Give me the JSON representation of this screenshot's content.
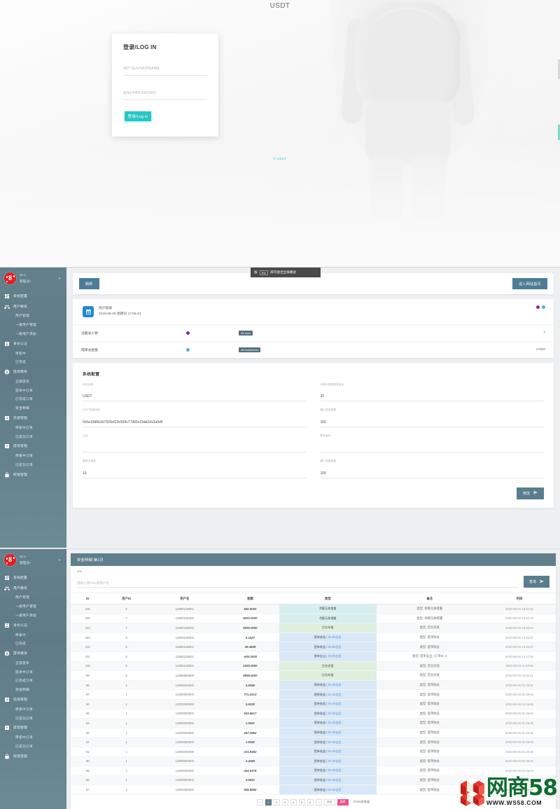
{
  "login": {
    "brand": "USDT",
    "title": "登录/LOG IN",
    "username_placeholder": "用户名/USERNAME",
    "password_placeholder": "密码/PASSWORD",
    "submit_label": "登录/Log in",
    "copyright": "© USDT"
  },
  "fullscreen_hint": {
    "prefix": "按",
    "key": "Esc",
    "suffix": "即可退出全屏模式"
  },
  "sidebar": {
    "user_id": "ID:1",
    "user_greeting": "管理员!",
    "caret": "▼",
    "items": [
      {
        "label": "系统配置",
        "icon": "grid-icon",
        "level": "top"
      },
      {
        "label": "用户模块",
        "icon": "users-icon",
        "level": "top"
      },
      {
        "label": "用户管理",
        "icon": "",
        "level": "child"
      },
      {
        "label": "一级用户管理",
        "icon": "",
        "level": "child"
      },
      {
        "label": "一级用户添加",
        "icon": "",
        "level": "child"
      },
      {
        "label": "身份认证",
        "icon": "id-card-icon",
        "level": "top"
      },
      {
        "label": "审核中",
        "icon": "",
        "level": "child"
      },
      {
        "label": "已完成",
        "icon": "",
        "level": "child"
      },
      {
        "label": "提单模块",
        "icon": "coin-icon",
        "level": "top"
      },
      {
        "label": "全部提单",
        "icon": "",
        "level": "child"
      },
      {
        "label": "提单中订单",
        "icon": "",
        "level": "child"
      },
      {
        "label": "已完成订单",
        "icon": "",
        "level": "child"
      },
      {
        "label": "资金明细",
        "icon": "",
        "level": "child"
      },
      {
        "label": "充值管理",
        "icon": "login-arrow-icon",
        "level": "top"
      },
      {
        "label": "审核中订单",
        "icon": "",
        "level": "child"
      },
      {
        "label": "已成功订单",
        "icon": "",
        "level": "child"
      },
      {
        "label": "提现管理",
        "icon": "export-icon",
        "level": "top"
      },
      {
        "label": "审核中订单",
        "icon": "",
        "level": "child"
      },
      {
        "label": "已成功订单",
        "icon": "",
        "level": "child"
      },
      {
        "label": "权限管理",
        "icon": "lock-icon",
        "level": "top"
      }
    ]
  },
  "admin": {
    "refresh_label": "刷新",
    "enter_site_label": "进入网站首页",
    "stats": {
      "icon": "calendar-chart-icon",
      "heading": "统计报表",
      "datetime": "2020-08-09  星期日  17:05:43",
      "rows": [
        {
          "label": "注册总人数",
          "tag": "All User",
          "value": "7",
          "color": "#8e24aa"
        },
        {
          "label": "提单总金额",
          "tag": "All Investment",
          "value": "17500",
          "color": "#5aa9e6"
        }
      ]
    },
    "config": {
      "title": "系统配置",
      "fields_left": [
        {
          "label": "站点名称",
          "value": "USDT"
        },
        {
          "label": "USDT收款地址",
          "value": "0x5a19d6b1b7920ef12e933c77d93c15ab2d13a9d5"
        },
        {
          "label": "公告",
          "value": ""
        },
        {
          "label": "提现手续费",
          "value": "10"
        }
      ],
      "fields_right": [
        {
          "label": "分享代理奖励奖金比",
          "value": "20"
        },
        {
          "label": "最小投资金额",
          "value": "100"
        },
        {
          "label": "联系我们",
          "value": ""
        },
        {
          "label": "最小充值金额",
          "value": "100"
        }
      ],
      "submit_label": "修改",
      "submit_icon": "send-icon"
    }
  },
  "fund_table": {
    "title": "资金明细-第1页",
    "search_label": "搜索",
    "search_placeholder": "请输入用户ID或用户名",
    "search_value": "",
    "search_button": "查询",
    "search_icon": "send-icon",
    "columns": [
      "ID",
      "用户ID",
      "用户名",
      "金额",
      "类型",
      "备注",
      "时间"
    ],
    "rows": [
      {
        "id": "106",
        "uid": "6",
        "user": "13800138001",
        "amount": "500.0000",
        "type": "余额无故增量",
        "type_sub": "",
        "tone": "teal",
        "remark": "类型: 余额无故增量",
        "time": "2020-08-03 16:57:32"
      },
      {
        "id": "105",
        "uid": "7",
        "user": "13800138200",
        "amount": "5000.0000",
        "type": "余额无故增量",
        "type_sub": "",
        "tone": "teal",
        "remark": "类型: 余额无故增量",
        "time": "2020-08-03 16:51:13"
      },
      {
        "id": "104",
        "uid": "7",
        "user": "13800138200",
        "amount": "8000.0000",
        "type": "后台充值",
        "type_sub": "",
        "tone": "green",
        "remark": "类型: 后台充值",
        "time": "2020-08-03 16:45:54"
      },
      {
        "id": "103",
        "uid": "6",
        "user": "13800138001",
        "amount": "0.1527",
        "type": "提单收益",
        "type_sub": "| ID-4/6会员",
        "tone": "blue",
        "remark": "类型: 提单收益",
        "time": "2020-08-03 14:25:37"
      },
      {
        "id": "102",
        "uid": "6",
        "user": "13800138001",
        "amount": "25.4949",
        "type": "提单收益",
        "type_sub": "| ID-4/6会员",
        "tone": "blue",
        "remark": "类型: 提单收益",
        "time": "2020-08-03 14:25:37"
      },
      {
        "id": "101",
        "uid": "6",
        "user": "13800138001",
        "amount": "-500.0000",
        "type": "提单支出",
        "type_sub": "| ID-4/6会员",
        "tone": "blue",
        "remark": "类型: 提单支出 | 订单ID: 4",
        "time": "2020-08-03 14:17:56"
      },
      {
        "id": "100",
        "uid": "6",
        "user": "13800138001",
        "amount": "1000.0000",
        "type": "后台充值",
        "type_sub": "",
        "tone": "green",
        "remark": "类型: 后台充值",
        "time": "2020-08-03 11:33:50"
      },
      {
        "id": "99",
        "uid": "5",
        "user": "13888888889",
        "amount": "9999.0000",
        "type": "后台充值",
        "type_sub": "",
        "tone": "green",
        "remark": "类型: 后台充值",
        "time": "2020-08-03 03:32:21"
      },
      {
        "id": "98",
        "uid": "1",
        "user": "13000000000",
        "amount": "4.6286",
        "type": "提单收益",
        "type_sub": "| ID-1/6会员",
        "tone": "blue",
        "remark": "类型: 提单收益",
        "time": "2020-08-03 01:29:51"
      },
      {
        "id": "97",
        "uid": "1",
        "user": "13000000000",
        "amount": "771.4313",
        "type": "提单收益",
        "type_sub": "| ID-1/6会员",
        "tone": "blue",
        "remark": "类型: 提单收益",
        "time": "2020-08-03 01:29:48"
      },
      {
        "id": "96",
        "uid": "1",
        "user": "13000000000",
        "amount": "3.6339",
        "type": "提单收益",
        "type_sub": "| ID-1/6会员",
        "tone": "blue",
        "remark": "类型: 提单收益",
        "time": "2020-08-03 01:29:45"
      },
      {
        "id": "95",
        "uid": "1",
        "user": "13000000000",
        "amount": "503.6617",
        "type": "提单收益",
        "type_sub": "| ID-1/6会员",
        "tone": "blue",
        "remark": "类型: 提单收益",
        "time": "2020-08-03 01:29:42"
      },
      {
        "id": "94",
        "uid": "1",
        "user": "13000000000",
        "amount": "1.6041",
        "type": "提单收益",
        "type_sub": "| ID-1/6会员",
        "tone": "blue",
        "remark": "类型: 提单收益",
        "time": "2020-08-03 01:29:39"
      },
      {
        "id": "93",
        "uid": "1",
        "user": "13000000000",
        "amount": "267.3982",
        "type": "提单收益",
        "type_sub": "| ID-1/6会员",
        "tone": "blue",
        "remark": "类型: 提单收益",
        "time": "2020-08-03 01:29:36"
      },
      {
        "id": "92",
        "uid": "1",
        "user": "13000000000",
        "amount": "1.9392",
        "type": "提单收益",
        "type_sub": "| ID-1/6会员",
        "tone": "blue",
        "remark": "类型: 提单收益",
        "time": "2020-08-03 01:29:33"
      },
      {
        "id": "91",
        "uid": "1",
        "user": "13000000000",
        "amount": "321.9382",
        "type": "提单收益",
        "type_sub": "| ID-1/6会员",
        "tone": "blue",
        "remark": "类型: 提单收益",
        "time": "2020-08-03 01:29:30"
      },
      {
        "id": "90",
        "uid": "1",
        "user": "13000000000",
        "amount": "2.4258",
        "type": "提单收益",
        "type_sub": "| ID-1/6会员",
        "tone": "blue",
        "remark": "类型: 提单收益",
        "time": "2020-08-03 01:29:27"
      },
      {
        "id": "89",
        "uid": "1",
        "user": "13000000000",
        "amount": "403.6376",
        "type": "提单收益",
        "type_sub": "| ID-1/6会员",
        "tone": "blue",
        "remark": "类型: 提单收益",
        "time": "2020-08-03 01:29:24"
      },
      {
        "id": "88",
        "uid": "1",
        "user": "13000000000",
        "amount": "3.6531",
        "type": "提单收益",
        "type_sub": "| ID-1/6会员",
        "tone": "blue",
        "remark": "类型: 提单收益",
        "time": "2020-08-03 01:29:21"
      },
      {
        "id": "87",
        "uid": "1",
        "user": "13000000000",
        "amount": "608.8594",
        "type": "提单收益",
        "type_sub": "| ID-1/6会员",
        "tone": "blue",
        "remark": "类型: 提单收益",
        "time": "2020-08-03 01:29:18"
      }
    ],
    "pagination": {
      "prev": "‹",
      "pages": [
        "1",
        "2",
        "3",
        "4",
        "5",
        "6"
      ],
      "active": "1",
      "next": "›",
      "jump_placeholder": "页码",
      "go_label": "跳转",
      "total": "共106条数据"
    }
  },
  "watermark": {
    "cn": "网商58",
    "url": "WWW.WS58.COM"
  },
  "colors": {
    "accent_teal": "#27c6c6",
    "sidebar": "#63808c",
    "primary": "#5a7d8d",
    "pink": "#ef4f91"
  }
}
